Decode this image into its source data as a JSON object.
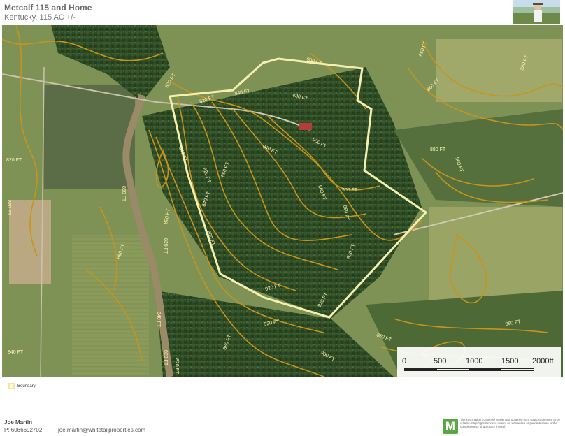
{
  "header": {
    "title": "Metcalf 115 and Home",
    "subtitle": "Kentucky, 115 AC +/-"
  },
  "map": {
    "contour_color": "#c8941a",
    "boundary_color": "#f6f0b0",
    "contour_labels": [
      "820 FT",
      "840 FT",
      "860 FT",
      "880 FT",
      "900 FT",
      "920 FT"
    ],
    "scale": {
      "labels": [
        "0",
        "500",
        "1000",
        "1500",
        "2000ft"
      ]
    }
  },
  "legend": {
    "boundary_label": "Boundary"
  },
  "footer": {
    "agent_name": "Joe Martin",
    "phone": "P: 6066692702",
    "email": "joe.martin@whitetailproperties.com",
    "logo_letter": "M",
    "disclaimer": "The information contained herein was obtained from sources deemed to be reliable. MapRight Services makes no warranties or guarantees as to the completeness or accuracy thereof."
  }
}
